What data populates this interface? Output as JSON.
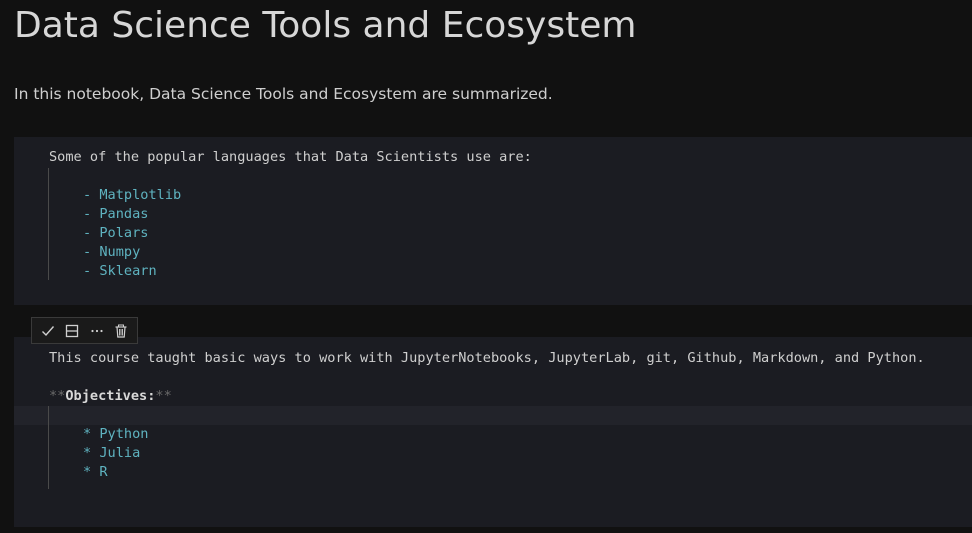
{
  "markdown": {
    "title": "Data Science Tools and Ecosystem",
    "intro": "In this notebook, Data Science Tools and Ecosystem are summarized."
  },
  "cell1": {
    "heading": "Some of the popular languages that Data Scientists use are:",
    "items": [
      "- Matplotlib",
      "- Pandas",
      "- Polars",
      "- Numpy",
      "- Sklearn"
    ]
  },
  "cell2": {
    "line1": "This course taught basic ways to work with JupyterNotebooks, JupyterLab, git, Github, Markdown, and Python.",
    "objectives_prefix": "**",
    "objectives_label": "Objectives:",
    "objectives_suffix": "**",
    "items": [
      "* Python",
      "* Julia",
      "* R"
    ]
  },
  "toolbar": {
    "icons": [
      "check-icon",
      "split-icon",
      "more-icon",
      "trash-icon"
    ]
  }
}
